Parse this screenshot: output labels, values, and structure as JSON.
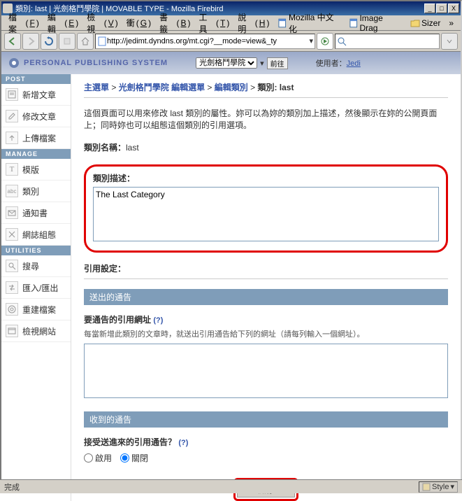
{
  "window": {
    "title": "類別: last | 光劍格鬥學院 | MOVABLE TYPE - Mozilla Firebird",
    "min": "_",
    "max": "□",
    "close": "X"
  },
  "menu": {
    "items": [
      {
        "label": "檔案",
        "accel": "F"
      },
      {
        "label": "編輯",
        "accel": "E"
      },
      {
        "label": "檢視",
        "accel": "V"
      },
      {
        "label": "衝",
        "accel": "G"
      },
      {
        "label": "書籤",
        "accel": "B"
      },
      {
        "label": "工具",
        "accel": "T"
      },
      {
        "label": "說明",
        "accel": "H"
      }
    ],
    "bookmarks": [
      {
        "label": "Mozilla 中文化"
      },
      {
        "label": "Image Drag"
      },
      {
        "label": "Sizer"
      }
    ]
  },
  "toolbar": {
    "url": "http://jedimt.dyndns.org/mt.cgi?__mode=view&_ty"
  },
  "mt_header": {
    "tagline": "PERSONAL PUBLISHING SYSTEM",
    "jump_options": [
      "光劍格鬥學院"
    ],
    "jump_btn": "前往",
    "user_label": "使用者：",
    "user_link": "Jedi"
  },
  "sidebar": {
    "sections": [
      {
        "header": "POST",
        "items": [
          {
            "label": "新增文章"
          },
          {
            "label": "修改文章"
          },
          {
            "label": "上傳檔案"
          }
        ]
      },
      {
        "header": "MANAGE",
        "items": [
          {
            "label": "模版"
          },
          {
            "label": "類別"
          },
          {
            "label": "通知書"
          },
          {
            "label": "網誌組態"
          }
        ]
      },
      {
        "header": "UTILITIES",
        "items": [
          {
            "label": "搜尋"
          },
          {
            "label": "匯入/匯出"
          },
          {
            "label": "重建檔案"
          },
          {
            "label": "檢視網站"
          }
        ]
      }
    ]
  },
  "breadcrumb": {
    "parts": [
      "主選單",
      "光劍格鬥學院",
      "編輯選單",
      "編輯類別",
      "類別: last"
    ],
    "sep": " > "
  },
  "page": {
    "intro": "這個頁面可以用來修改 last 類別的屬性。妳可以為妳的類別加上描述，然後顯示在妳的公開頁面上；同時妳也可以組態這個類別的引用選項。",
    "name_label": "類別名稱：",
    "name_value": "last",
    "desc_label": "類別描述：",
    "desc_value": "The Last Category",
    "tb_settings_label": "引用設定：",
    "sent_header": "送出的通告",
    "ping_urls_label": "要通告的引用網址",
    "ping_urls_help": "(?)",
    "ping_urls_hint": "每當新增此類別的文章時，就送出引用通告給下列的網址（請每列輸入一個網址）。",
    "ping_urls_value": "",
    "recv_header": "收到的通告",
    "accept_label": "接受送進來的引用通告？",
    "accept_help": "(?)",
    "accept_on": "啟用",
    "accept_off": "關閉",
    "save_btn": "儲存"
  },
  "status": {
    "text": "完成",
    "style": "Style"
  }
}
